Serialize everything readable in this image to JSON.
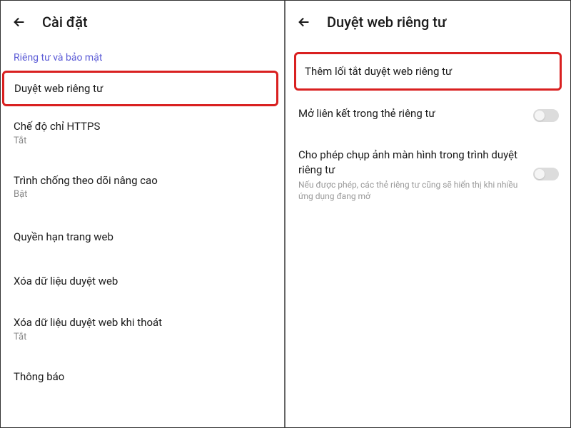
{
  "left": {
    "title": "Cài đặt",
    "section": "Riêng tư và bảo mật",
    "items": [
      {
        "title": "Duyệt web riêng tư",
        "highlighted": true
      },
      {
        "title": "Chế độ chỉ HTTPS",
        "sub": "Tắt"
      },
      {
        "title": "Trình chống theo dõi nâng cao",
        "sub": "Bật"
      },
      {
        "title": "Quyền hạn trang web"
      },
      {
        "title": "Xóa dữ liệu duyệt web"
      },
      {
        "title": "Xóa dữ liệu duyệt web khi thoát",
        "sub": "Tắt"
      },
      {
        "title": "Thông báo"
      }
    ]
  },
  "right": {
    "title": "Duyệt web riêng tư",
    "shortcut": "Thêm lối tắt duyệt web riêng tư",
    "toggle1": {
      "title": "Mở liên kết trong thẻ riêng tư",
      "on": false
    },
    "toggle2": {
      "title": "Cho phép chụp ảnh màn hình trong trình duyệt riêng tư",
      "desc": "Nếu được phép, các thẻ riêng tư cũng sẽ hiển thị khi nhiều ứng dụng đang mở",
      "on": false
    }
  }
}
